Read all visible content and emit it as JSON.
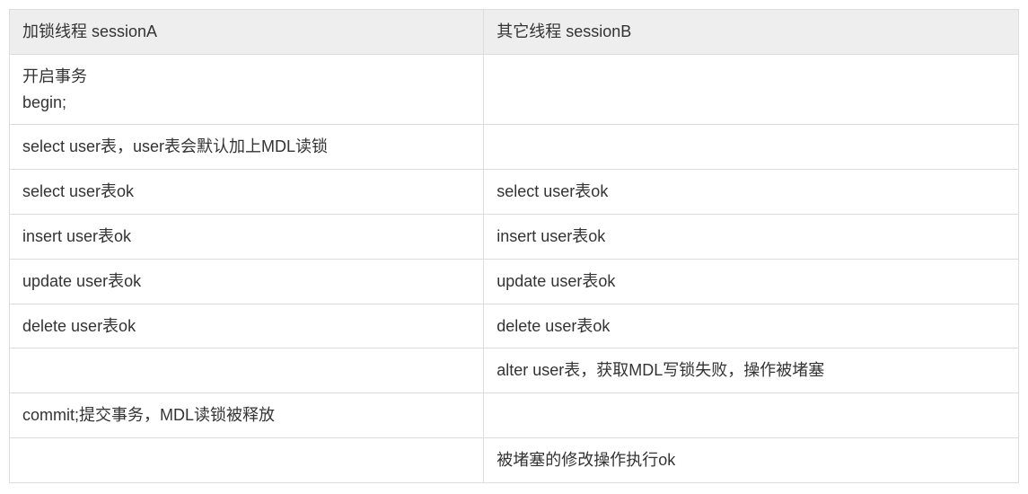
{
  "table": {
    "headers": {
      "colA": "加锁线程 sessionA",
      "colB": "其它线程 sessionB"
    },
    "rows": [
      {
        "a": "开启事务\nbegin;",
        "b": ""
      },
      {
        "a": "select user表，user表会默认加上MDL读锁",
        "b": ""
      },
      {
        "a": "select user表ok",
        "b": "select user表ok"
      },
      {
        "a": "insert user表ok",
        "b": "insert user表ok"
      },
      {
        "a": "update user表ok",
        "b": "update user表ok"
      },
      {
        "a": "delete user表ok",
        "b": "delete user表ok"
      },
      {
        "a": "",
        "b": "alter user表，获取MDL写锁失败，操作被堵塞"
      },
      {
        "a": "commit;提交事务，MDL读锁被释放",
        "b": ""
      },
      {
        "a": "",
        "b": "被堵塞的修改操作执行ok"
      }
    ]
  }
}
